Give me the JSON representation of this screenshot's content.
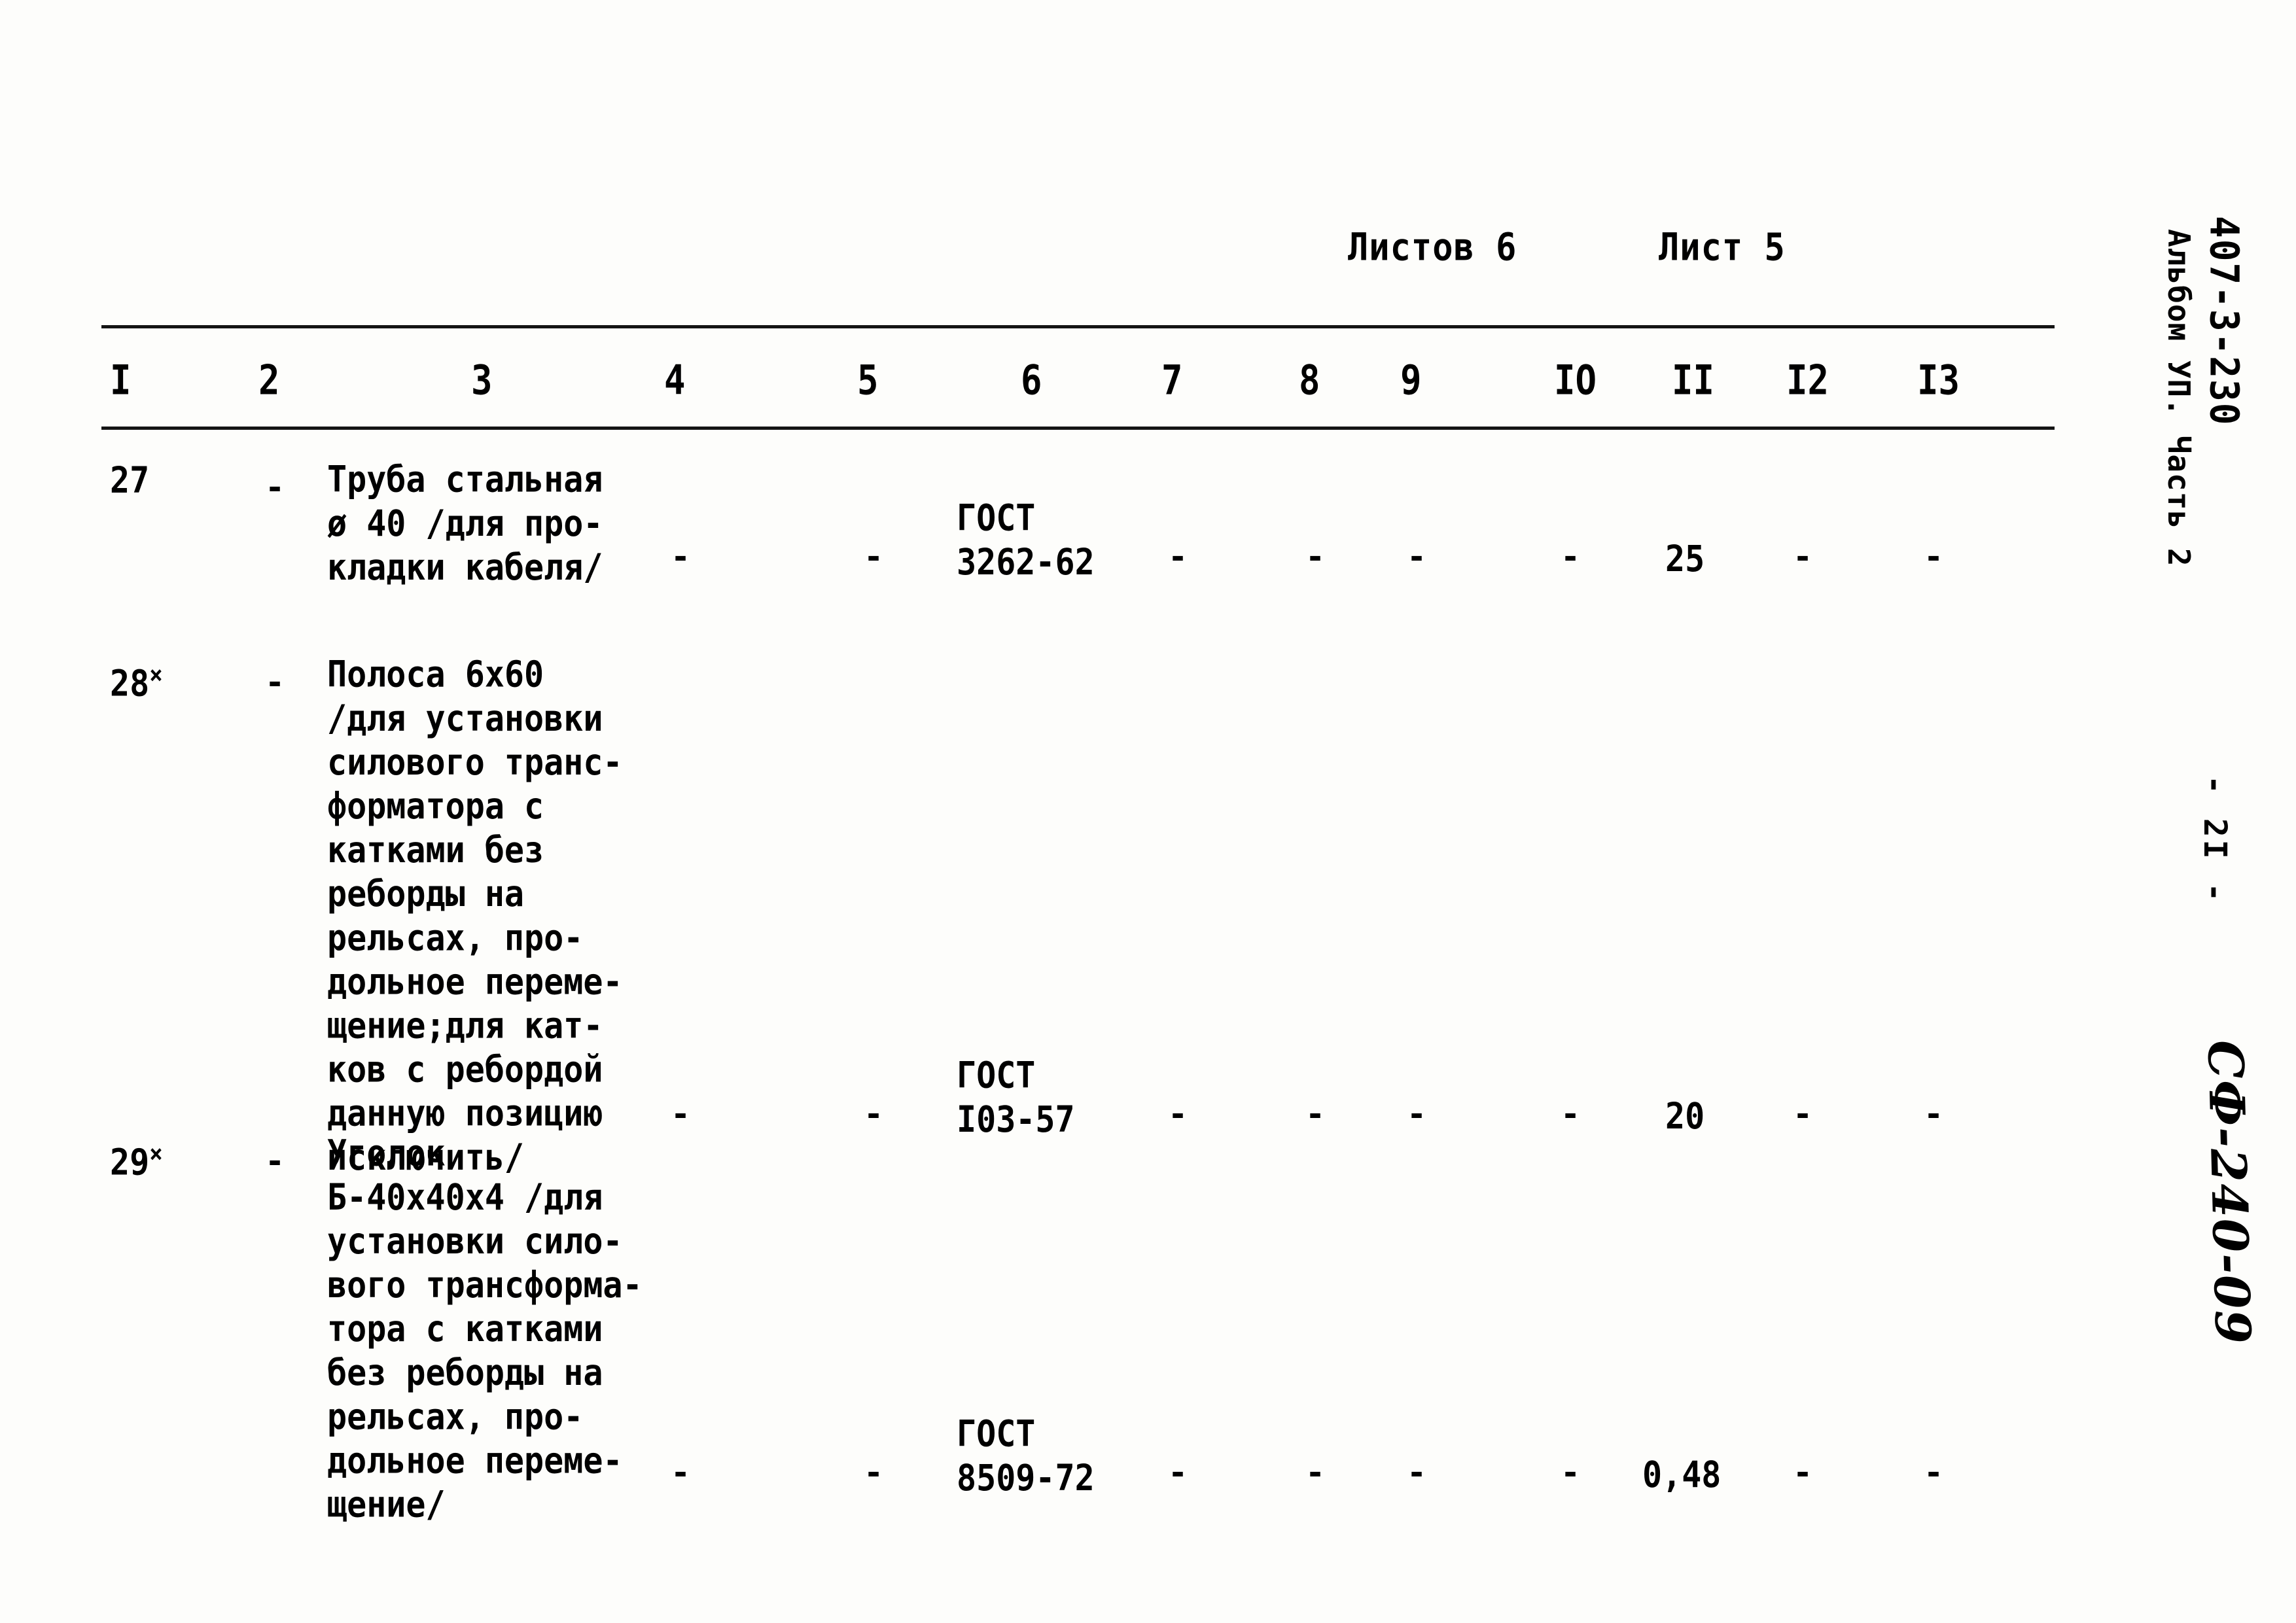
{
  "document": {
    "sheets_total_label": "Листов 6",
    "sheet_current_label": "Лист 5",
    "code_main": "407-3-230",
    "album_part": "Альбом УП. Часть 2",
    "page_number": "- 2I -",
    "hand_stamp": "СФ-240-09"
  },
  "table": {
    "column_headers": [
      "I",
      "2",
      "3",
      "4",
      "5",
      "6",
      "7",
      "8",
      "9",
      "IO",
      "II",
      "I2",
      "I3"
    ],
    "rows": [
      {
        "pos": "27",
        "pos_marked": false,
        "col2": "-",
        "description": "Труба стальная\nø 40 /для про-\nкладки кабеля/",
        "col4": "-",
        "col5": "-",
        "gost": "ГОСТ\n3262-62",
        "col7": "-",
        "col8": "-",
        "col9": "-",
        "col10": "-",
        "col11": "25",
        "col12": "-",
        "col13": "-"
      },
      {
        "pos": "28",
        "pos_marked": true,
        "col2": "-",
        "description": "Полоса 6х60\n/для установки\nсилового транс-\nформатора с\nкатками без\nреборды на\nрельсах, про-\nдольное переме-\nщение;для кат-\nков с ребордой\nданную позицию\nисключить/",
        "col4": "-",
        "col5": "-",
        "gost": "ГОСТ\nI03-57",
        "col7": "-",
        "col8": "-",
        "col9": "-",
        "col10": "-",
        "col11": "20",
        "col12": "-",
        "col13": "-"
      },
      {
        "pos": "29",
        "pos_marked": true,
        "col2": "-",
        "description": "Уголок\nБ-40х40х4 /для\nустановки сило-\nвого трансформа-\nтора с катками\nбез реборды на\nрельсах, про-\nдольное переме-\nщение/",
        "col4": "-",
        "col5": "-",
        "gost": "ГОСТ\n8509-72",
        "col7": "-",
        "col8": "-",
        "col9": "-",
        "col10": "-",
        "col11": "0,48",
        "col12": "-",
        "col13": "-"
      }
    ]
  }
}
